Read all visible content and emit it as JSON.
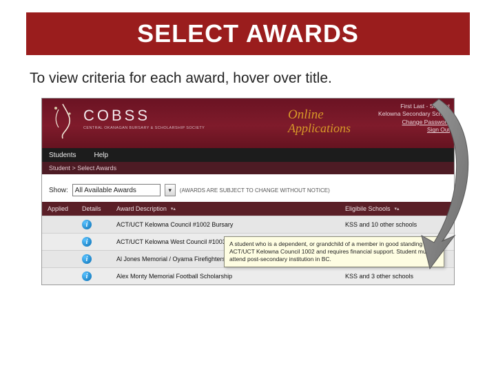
{
  "slide": {
    "title": "SELECT AWARDS",
    "instruction": "To view criteria for each award, hover over title."
  },
  "banner": {
    "brand_name": "COBSS",
    "brand_sub": "CENTRAL OKANAGAN BURSARY & SCHOLARSHIP SOCIETY",
    "apps_line1": "Online",
    "apps_line2": "Applications",
    "user": {
      "line1": "First Last - Student",
      "line2": "Kelowna Secondary School",
      "change_pw": "Change Password",
      "signout": "Sign Out"
    }
  },
  "nav": {
    "students": "Students",
    "help": "Help"
  },
  "crumb": {
    "text": "Student > Select Awards"
  },
  "filter": {
    "show_label": "Show:",
    "selected": "All Available Awards",
    "note": "(AWARDS ARE SUBJECT TO CHANGE WITHOUT NOTICE)"
  },
  "table": {
    "headers": {
      "applied": "Applied",
      "details": "Details",
      "desc": "Award Description",
      "elig": "Eligibile Schools"
    },
    "rows": [
      {
        "desc": "ACT/UCT Kelowna Council #1002 Bursary",
        "elig": "KSS and 10 other schools"
      },
      {
        "desc": "ACT/UCT Kelowna West Council #1003 Bursary",
        "elig": ""
      },
      {
        "desc": "Al Jones Memorial / Oyama Firefighters",
        "elig": ""
      },
      {
        "desc": "Alex Monty Memorial Football Scholarship",
        "elig": "KSS and 3 other schools"
      }
    ]
  },
  "tooltip": {
    "text": "A student who is a dependent, or grandchild of a member in good standing of ACT/UCT Kelowna Council 1002 and requires financial support. Student must attend post-secondary institution in BC."
  }
}
